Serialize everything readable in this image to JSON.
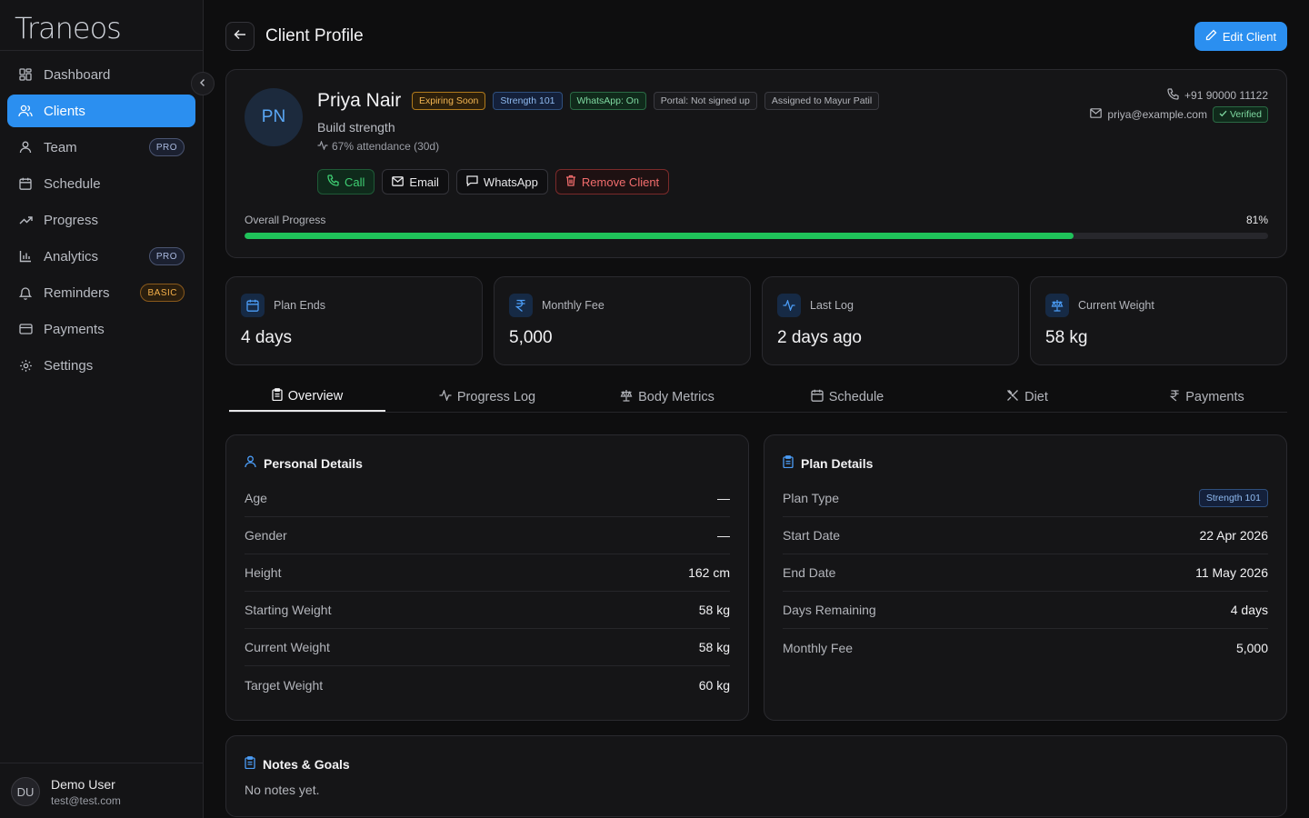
{
  "app": {
    "logo": "Traneos"
  },
  "sidebar": {
    "items": [
      {
        "label": "Dashboard",
        "icon": "dashboard-icon"
      },
      {
        "label": "Clients",
        "icon": "users-icon",
        "active": true
      },
      {
        "label": "Team",
        "icon": "team-icon",
        "badge": "PRO"
      },
      {
        "label": "Schedule",
        "icon": "calendar-icon"
      },
      {
        "label": "Progress",
        "icon": "trending-up-icon"
      },
      {
        "label": "Analytics",
        "icon": "bar-chart-icon",
        "badge": "PRO"
      },
      {
        "label": "Reminders",
        "icon": "bell-icon",
        "badge": "BASIC"
      },
      {
        "label": "Payments",
        "icon": "credit-card-icon"
      },
      {
        "label": "Settings",
        "icon": "gear-icon"
      }
    ],
    "user": {
      "initials": "DU",
      "name": "Demo User",
      "email": "test@test.com"
    }
  },
  "header": {
    "title": "Client Profile",
    "edit_label": "Edit Client"
  },
  "profile": {
    "initials": "PN",
    "name": "Priya Nair",
    "chips": [
      "Expiring Soon",
      "Strength 101",
      "WhatsApp: On",
      "Portal: Not signed up",
      "Assigned to Mayur Patil"
    ],
    "goal": "Build strength",
    "attendance": "67% attendance (30d)",
    "actions": {
      "call": "Call",
      "email": "Email",
      "whatsapp": "WhatsApp",
      "remove": "Remove Client"
    },
    "phone": "+91 90000 11122",
    "email": "priya@example.com",
    "verified": "Verified",
    "progress_label": "Overall Progress",
    "progress_text": "81%",
    "progress_fraction": 0.81
  },
  "stats": [
    {
      "label": "Plan Ends",
      "value": "4 days",
      "icon": "calendar-icon"
    },
    {
      "label": "Monthly Fee",
      "value": "5,000",
      "icon": "rupee-icon"
    },
    {
      "label": "Last Log",
      "value": "2 days ago",
      "icon": "activity-icon"
    },
    {
      "label": "Current Weight",
      "value": "58 kg",
      "icon": "scale-icon"
    }
  ],
  "tabs": [
    {
      "label": "Overview",
      "icon": "clipboard-icon",
      "active": true
    },
    {
      "label": "Progress Log",
      "icon": "activity-icon"
    },
    {
      "label": "Body Metrics",
      "icon": "scale-icon"
    },
    {
      "label": "Schedule",
      "icon": "calendar-icon"
    },
    {
      "label": "Diet",
      "icon": "utensils-icon"
    },
    {
      "label": "Payments",
      "icon": "rupee-icon"
    }
  ],
  "personal": {
    "title": "Personal Details",
    "rows": [
      {
        "k": "Age",
        "v": "—"
      },
      {
        "k": "Gender",
        "v": "—"
      },
      {
        "k": "Height",
        "v": "162 cm"
      },
      {
        "k": "Starting Weight",
        "v": "58 kg"
      },
      {
        "k": "Current Weight",
        "v": "58 kg"
      },
      {
        "k": "Target Weight",
        "v": "60 kg"
      }
    ]
  },
  "plan": {
    "title": "Plan Details",
    "plan_type_label": "Plan Type",
    "plan_type": "Strength 101",
    "rows": [
      {
        "k": "Start Date",
        "v": "22 Apr 2026"
      },
      {
        "k": "End Date",
        "v": "11 May 2026"
      },
      {
        "k": "Days Remaining",
        "v": "4 days"
      },
      {
        "k": "Monthly Fee",
        "v": "5,000"
      }
    ]
  },
  "notes": {
    "title": "Notes & Goals",
    "text": "No notes yet."
  },
  "colors": {
    "accent": "#2b8ff0",
    "progress": "#1fc25a",
    "danger": "#f26d6d",
    "bg": "#0e0e0f"
  }
}
